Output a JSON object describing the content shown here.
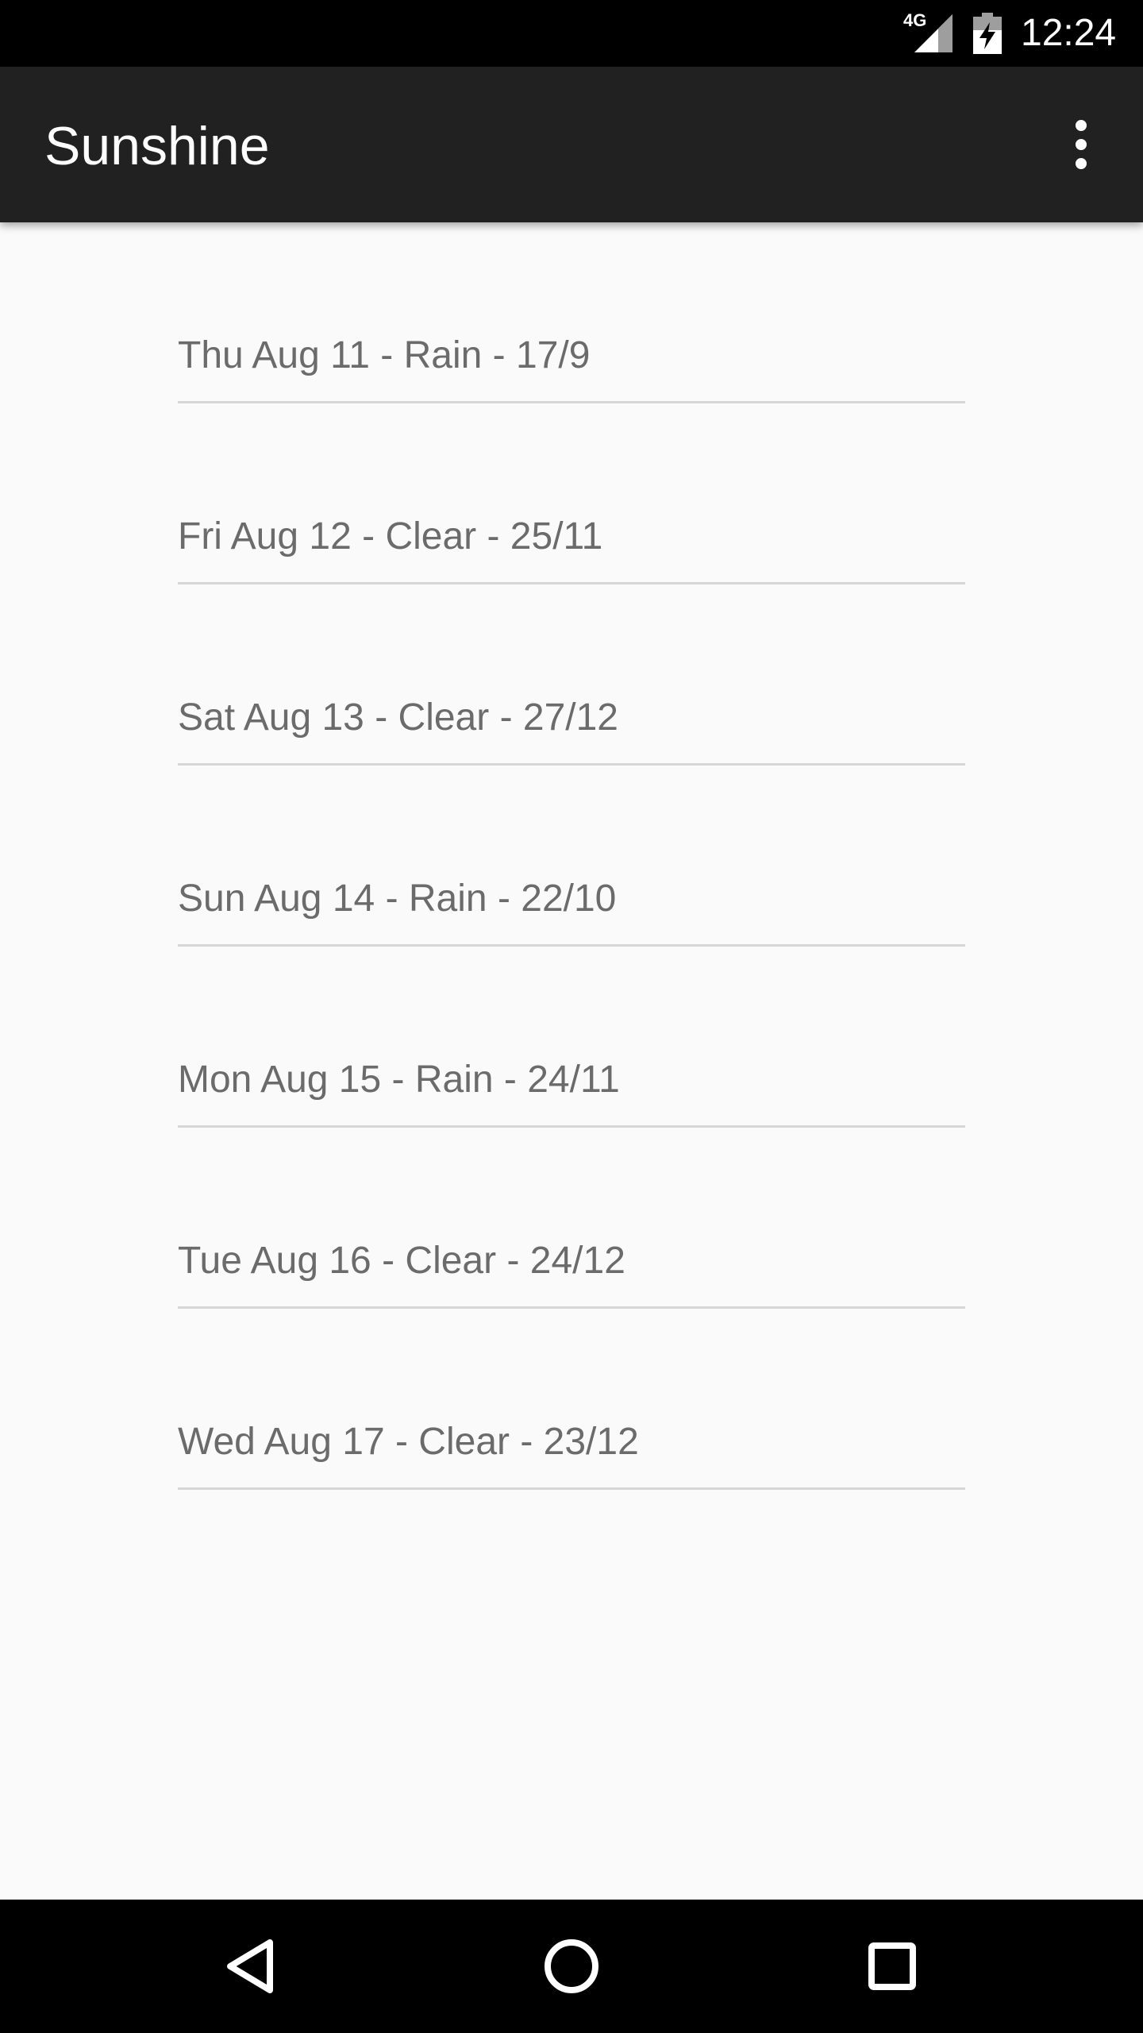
{
  "status_bar": {
    "network": "4G",
    "time": "12:24",
    "icons": [
      "signal-icon",
      "battery-charging-icon"
    ]
  },
  "app_bar": {
    "title": "Sunshine",
    "overflow_icon": "more-vert-icon"
  },
  "forecast": [
    {
      "text": "Thu Aug 11 - Rain - 17/9"
    },
    {
      "text": "Fri Aug 12 - Clear - 25/11"
    },
    {
      "text": "Sat Aug 13 - Clear - 27/12"
    },
    {
      "text": "Sun Aug 14 - Rain - 22/10"
    },
    {
      "text": "Mon Aug 15 - Rain - 24/11"
    },
    {
      "text": "Tue Aug 16 - Clear - 24/12"
    },
    {
      "text": "Wed Aug 17 - Clear - 23/12"
    }
  ],
  "nav_bar": {
    "icons": [
      "back-icon",
      "home-icon",
      "recents-icon"
    ]
  },
  "colors": {
    "status_bar": "#000000",
    "app_bar": "#212121",
    "background": "#fafafa",
    "list_text": "#6b6b6b",
    "divider": "#d6d6d6"
  }
}
